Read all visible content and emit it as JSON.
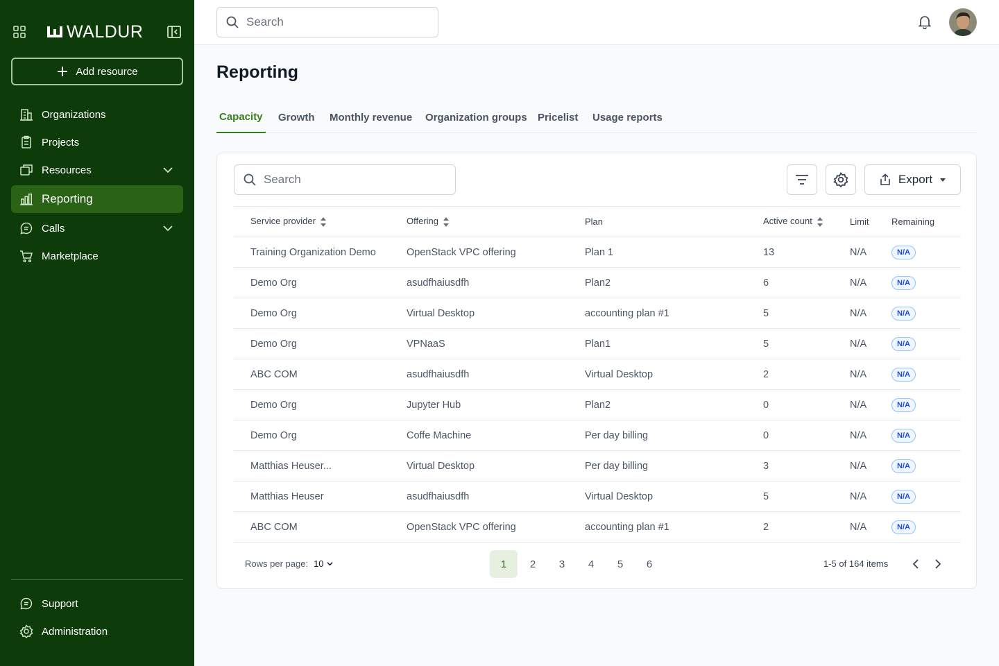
{
  "brand": {
    "name": "WALDUR"
  },
  "sidebar": {
    "add_label": "Add resource",
    "items": [
      {
        "label": "Organizations",
        "icon": "building-icon"
      },
      {
        "label": "Projects",
        "icon": "clipboard-icon"
      },
      {
        "label": "Resources",
        "icon": "windows-icon"
      },
      {
        "label": "Reporting",
        "icon": "bar-chart-icon"
      },
      {
        "label": "Calls",
        "icon": "chat-icon"
      },
      {
        "label": "Marketplace",
        "icon": "cart-icon"
      }
    ],
    "bottom": [
      {
        "label": "Support",
        "icon": "chat-icon"
      },
      {
        "label": "Administration",
        "icon": "gear-icon"
      }
    ]
  },
  "topbar": {
    "search_placeholder": "Search"
  },
  "page": {
    "title": "Reporting"
  },
  "tabs": [
    "Capacity",
    "Growth",
    "Monthly revenue",
    "Organization groups",
    "Pricelist",
    "Usage reports"
  ],
  "table": {
    "search_placeholder": "Search",
    "export_label": "Export",
    "columns": [
      "Service provider",
      "Offering",
      "Plan",
      "Active count",
      "Limit",
      "Remaining"
    ],
    "rows": [
      [
        "Training Organization Demo",
        "OpenStack VPC offering",
        "Plan 1",
        "13",
        "N/A",
        "N/A"
      ],
      [
        "Demo Org",
        "asudfhaiusdfh",
        "Plan2",
        "6",
        "N/A",
        "N/A"
      ],
      [
        "Demo Org",
        "Virtual Desktop",
        "accounting plan #1",
        "5",
        "N/A",
        "N/A"
      ],
      [
        "Demo Org",
        "VPNaaS",
        "Plan1",
        "5",
        "N/A",
        "N/A"
      ],
      [
        "ABC COM",
        "asudfhaiusdfh",
        "Virtual Desktop",
        "2",
        "N/A",
        "N/A"
      ],
      [
        "Demo Org",
        "Jupyter Hub",
        "Plan2",
        "0",
        "N/A",
        "N/A"
      ],
      [
        "Demo Org",
        "Coffe Machine",
        "Per day billing",
        "0",
        "N/A",
        "N/A"
      ],
      [
        "Matthias Heuser...",
        "Virtual Desktop",
        "Per day billing",
        "3",
        "N/A",
        "N/A"
      ],
      [
        "Matthias Heuser",
        "asudfhaiusdfh",
        "Virtual Desktop",
        "5",
        "N/A",
        "N/A"
      ],
      [
        "ABC COM",
        "OpenStack VPC offering",
        "accounting plan #1",
        "2",
        "N/A",
        "N/A"
      ]
    ]
  },
  "pagination": {
    "rows_label": "Rows per page:",
    "rows_value": "10",
    "pages": [
      "1",
      "2",
      "3",
      "4",
      "5",
      "6"
    ],
    "current": "1",
    "range": "1-5 of 164 items"
  },
  "colors": {
    "sidebar_bg": "#0d3b09",
    "accent": "#3a7d1f",
    "active_nav": "#2a6316"
  }
}
